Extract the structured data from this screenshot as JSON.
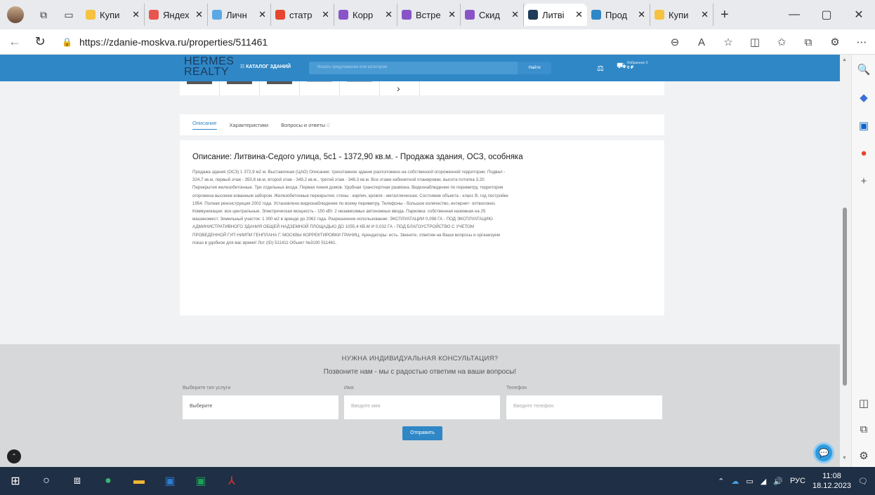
{
  "browser": {
    "tabs": [
      {
        "label": "Купи",
        "color": "#f5c242"
      },
      {
        "label": "Яндех",
        "color": "#e8554e"
      },
      {
        "label": "Личн",
        "color": "#5aa9e6"
      },
      {
        "label": "статр",
        "color": "#e8452e"
      },
      {
        "label": "Корр",
        "color": "#8a54c9"
      },
      {
        "label": "Встре",
        "color": "#8a54c9"
      },
      {
        "label": "Скид",
        "color": "#8a54c9"
      },
      {
        "label": "Литві",
        "color": "#1e3c5a"
      },
      {
        "label": "Прод",
        "color": "#2f87c6"
      },
      {
        "label": "Купи",
        "color": "#f5c242"
      }
    ],
    "close_glyph": "✕",
    "new_tab": "+",
    "url": "https://zdanie-moskva.ru/properties/511461"
  },
  "site": {
    "logo_line1": "HERMES",
    "logo_line2": "REALTY",
    "catalog": "☷ КАТАЛОГ ЗДАНИЙ",
    "search_placeholder": "Искать предложения или категории",
    "search_button": "Найти",
    "favorites_label": "Избранное 0",
    "favorites_sum": "0 ₽"
  },
  "tabs": {
    "description": "Описание",
    "characteristics": "Характеристики",
    "qa": "Вопросы и ответы",
    "qa_count": "0"
  },
  "description": {
    "title": "Описание: Литвина-Седого улица, 5с1 - 1372,90 кв.м. - Продажа здания, ОСЗ, особняка",
    "text": "Продажа здания (ОСЗ) 1 372,9 м2 м. Выставочная (ЦАО) Описание: трехэтажное здание расположено на собственной огороженной территории. Подвал - 324,7 кв.м, первый этаж - 350,8 кв.м, второй этаж - 349,2 кв.м., третий этаж - 348,3 кв.м. Все этажи кабинетной планировки, высота потолка 3.20. Перекрытия железобетонные. Три отдельных входа. Первая линия домов. Удобная транспортная развязка. Видеонаблюдение по периметру, территория огорожена высоким кованным забором. Железобетонные перекрытия, стены - кирпич, кровля - металлическая. Состояние объекта - класс В, год постройки 1954. Полная реконструкция 2002 года. Установлено видеонаблюдение по всему периметру. Телефоны - большое количество, интернет- оптволокно. Коммуникации: все центральные. Электрическая мощность - 150 кВт. 2 независимых автономных ввода. Парковка: собственная наземная на 25 машиномест. Земельный участок: 1 300 м2 в аренде до 2062 года. Разрешенное использование: ЭКСПЛУАТАЦИИ 0,098 ГА - ПОД ЭКСПЛУАТАЦИЮ АДМИНИСТРАТИВНОГО ЗДАНИЯ ОБЩЕЙ НАДЗЕМНОЙ ПЛОЩАДЬЮ ДО 1055,4 КВ.М И 0,032 ГА - ПОД БЛАГОУСТРОЙСТВО С УЧЕТОМ ПРОВЕДЕННОЙ ГУП НИИПИ ГЕНПЛАНА Г. МОСКВЫ КОРРЕКТИРОВКИ ГРАНИЦ. Арендаторы: есть. Звоните, ответим на Ваши вопросы и организуем показ в удобное для вас время! Лот (ID) 511411 Объект №3100 511461."
  },
  "consult": {
    "title": "НУЖНА ИНДИВИДУАЛЬНАЯ КОНСУЛЬТАЦИЯ?",
    "subtitle": "Позвоните нам - мы с радостью ответим на ваши вопросы!",
    "service_label": "Выберите тип услуги",
    "service_value": "Выберите",
    "name_label": "Имя",
    "name_placeholder": "Введите имя",
    "phone_label": "Телефон",
    "phone_placeholder": "Введите телефон",
    "submit": "Отправить"
  },
  "taskbar": {
    "lang": "РУС",
    "time": "11:08",
    "date": "18.12.2023"
  }
}
